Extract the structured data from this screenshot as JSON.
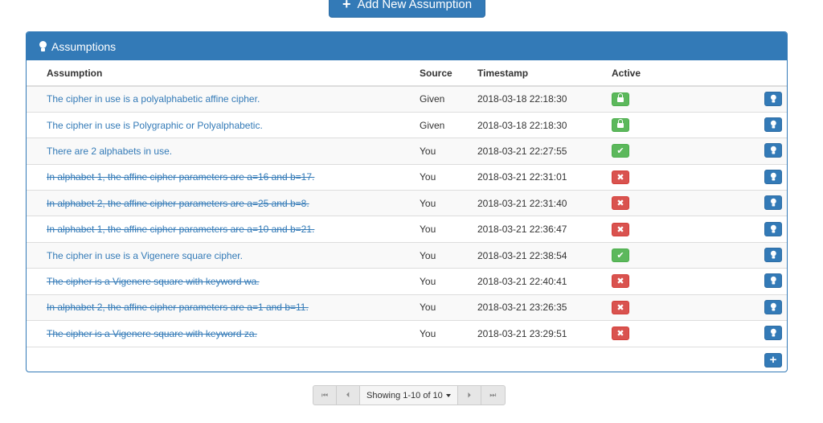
{
  "add_button": {
    "label": "Add New Assumption",
    "icon": "plus-icon"
  },
  "panel": {
    "title": "Assumptions",
    "icon": "lightbulb-icon"
  },
  "columns": {
    "assumption": "Assumption",
    "source": "Source",
    "timestamp": "Timestamp",
    "active": "Active"
  },
  "rows": [
    {
      "text": "The cipher in use is a polyalphabetic affine cipher.",
      "source": "Given",
      "timestamp": "2018-03-18 22:18:30",
      "status": "locked",
      "struck": false
    },
    {
      "text": "The cipher in use is Polygraphic or Polyalphabetic.",
      "source": "Given",
      "timestamp": "2018-03-18 22:18:30",
      "status": "locked",
      "struck": false
    },
    {
      "text": "There are 2 alphabets in use.",
      "source": "You",
      "timestamp": "2018-03-21 22:27:55",
      "status": "active",
      "struck": false
    },
    {
      "text": "In alphabet 1, the affine cipher parameters are a=16 and b=17.",
      "source": "You",
      "timestamp": "2018-03-21 22:31:01",
      "status": "inactive",
      "struck": true
    },
    {
      "text": "In alphabet 2, the affine cipher parameters are a=25 and b=8.",
      "source": "You",
      "timestamp": "2018-03-21 22:31:40",
      "status": "inactive",
      "struck": true
    },
    {
      "text": "In alphabet 1, the affine cipher parameters are a=10 and b=21.",
      "source": "You",
      "timestamp": "2018-03-21 22:36:47",
      "status": "inactive",
      "struck": true
    },
    {
      "text": "The cipher in use is a Vigenere square cipher.",
      "source": "You",
      "timestamp": "2018-03-21 22:38:54",
      "status": "active",
      "struck": false
    },
    {
      "text": "The cipher is a Vigenere square with keyword wa.",
      "source": "You",
      "timestamp": "2018-03-21 22:40:41",
      "status": "inactive",
      "struck": true
    },
    {
      "text": "In alphabet 2, the affine cipher parameters are a=1 and b=11.",
      "source": "You",
      "timestamp": "2018-03-21 23:26:35",
      "status": "inactive",
      "struck": true
    },
    {
      "text": "The cipher is a Vigenere square with keyword za.",
      "source": "You",
      "timestamp": "2018-03-21 23:29:51",
      "status": "inactive",
      "struck": true
    }
  ],
  "pager": {
    "label": "Showing 1-10 of 10"
  },
  "colors": {
    "primary": "#337ab7",
    "success": "#5cb85c",
    "danger": "#d9534f"
  }
}
